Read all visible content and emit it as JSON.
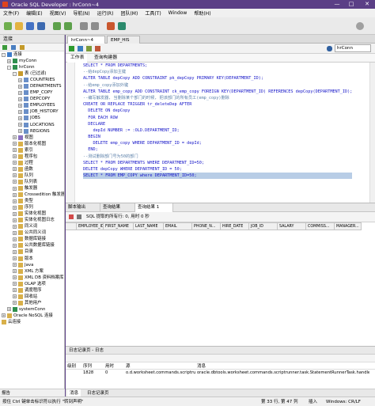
{
  "window": {
    "title": "Oracle SQL Developer : hrConn~4",
    "minimize": "—",
    "maximize": "□",
    "close": "✕"
  },
  "menu": [
    "文件(F)",
    "编辑(E)",
    "视图(V)",
    "导航(N)",
    "运行(R)",
    "团队(M)",
    "工具(T)",
    "Window",
    "帮助(H)"
  ],
  "sidebar": {
    "title": "连接",
    "items": [
      {
        "label": "连接",
        "depth": 0,
        "toggle": "-",
        "icon": "connections-icon"
      },
      {
        "label": "myConn",
        "depth": 1,
        "toggle": "+",
        "icon": "connection-icon"
      },
      {
        "label": "hrConn",
        "depth": 1,
        "toggle": "-",
        "icon": "connection-icon"
      },
      {
        "label": "表 (已过滤)",
        "depth": 2,
        "toggle": "-",
        "icon": "tables-icon"
      },
      {
        "label": "COUNTRIES",
        "depth": 3,
        "toggle": "+",
        "icon": "table-icon"
      },
      {
        "label": "DEPARTMENTS",
        "depth": 3,
        "toggle": "+",
        "icon": "table-icon"
      },
      {
        "label": "EMP_COPY",
        "depth": 3,
        "toggle": "+",
        "icon": "table-icon"
      },
      {
        "label": "DEPCOPY",
        "depth": 3,
        "toggle": "+",
        "icon": "table-icon"
      },
      {
        "label": "EMPLOYEES",
        "depth": 3,
        "toggle": "+",
        "icon": "table-icon"
      },
      {
        "label": "JOB_HISTORY",
        "depth": 3,
        "toggle": "+",
        "icon": "table-icon"
      },
      {
        "label": "JOBS",
        "depth": 3,
        "toggle": "+",
        "icon": "table-icon"
      },
      {
        "label": "LOCATIONS",
        "depth": 3,
        "toggle": "+",
        "icon": "table-icon"
      },
      {
        "label": "REGIONS",
        "depth": 3,
        "toggle": "+",
        "icon": "table-icon"
      },
      {
        "label": "视图",
        "depth": 2,
        "toggle": "+",
        "icon": "views-icon"
      },
      {
        "label": "版本化视图",
        "depth": 2,
        "toggle": "+",
        "icon": "folder-icon"
      },
      {
        "label": "索引",
        "depth": 2,
        "toggle": "+",
        "icon": "folder-icon"
      },
      {
        "label": "程序包",
        "depth": 2,
        "toggle": "+",
        "icon": "folder-icon"
      },
      {
        "label": "过程",
        "depth": 2,
        "toggle": "+",
        "icon": "folder-icon"
      },
      {
        "label": "函数",
        "depth": 2,
        "toggle": "+",
        "icon": "folder-icon"
      },
      {
        "label": "队列",
        "depth": 2,
        "toggle": "+",
        "icon": "folder-icon"
      },
      {
        "label": "队列表",
        "depth": 2,
        "toggle": "+",
        "icon": "folder-icon"
      },
      {
        "label": "触发器",
        "depth": 2,
        "toggle": "+",
        "icon": "folder-icon"
      },
      {
        "label": "Crossedition 触发器",
        "depth": 2,
        "toggle": "+",
        "icon": "folder-icon"
      },
      {
        "label": "类型",
        "depth": 2,
        "toggle": "+",
        "icon": "folder-icon"
      },
      {
        "label": "序列",
        "depth": 2,
        "toggle": "+",
        "icon": "folder-icon"
      },
      {
        "label": "实体化视图",
        "depth": 2,
        "toggle": "+",
        "icon": "folder-icon"
      },
      {
        "label": "实体化视图日志",
        "depth": 2,
        "toggle": "+",
        "icon": "folder-icon"
      },
      {
        "label": "同义词",
        "depth": 2,
        "toggle": "+",
        "icon": "folder-icon"
      },
      {
        "label": "公共同义词",
        "depth": 2,
        "toggle": "+",
        "icon": "folder-icon"
      },
      {
        "label": "数据库链接",
        "depth": 2,
        "toggle": "+",
        "icon": "folder-icon"
      },
      {
        "label": "公共数据库链接",
        "depth": 2,
        "toggle": "+",
        "icon": "folder-icon"
      },
      {
        "label": "目录",
        "depth": 2,
        "toggle": "+",
        "icon": "folder-icon"
      },
      {
        "label": "版本",
        "depth": 2,
        "toggle": "+",
        "icon": "folder-icon"
      },
      {
        "label": "Java",
        "depth": 2,
        "toggle": "+",
        "icon": "folder-icon"
      },
      {
        "label": "XML 方案",
        "depth": 2,
        "toggle": "+",
        "icon": "folder-icon"
      },
      {
        "label": "XML DB 资料档案库",
        "depth": 2,
        "toggle": "+",
        "icon": "folder-icon"
      },
      {
        "label": "OLAP 选项",
        "depth": 2,
        "toggle": "+",
        "icon": "folder-icon"
      },
      {
        "label": "调度程序",
        "depth": 2,
        "toggle": "+",
        "icon": "folder-icon"
      },
      {
        "label": "回收站",
        "depth": 2,
        "toggle": "+",
        "icon": "folder-icon"
      },
      {
        "label": "其他用户",
        "depth": 2,
        "toggle": "+",
        "icon": "folder-icon"
      },
      {
        "label": "systemConn",
        "depth": 1,
        "toggle": "+",
        "icon": "connection-icon"
      },
      {
        "label": "Oracle NoSQL 连接",
        "depth": 0,
        "toggle": "+",
        "icon": "folder-icon"
      },
      {
        "label": "云连接",
        "depth": 0,
        "toggle": "",
        "icon": "folder-icon"
      }
    ],
    "footer": "报告"
  },
  "doc_tabs": [
    "hrConn~4",
    "EMP_HIS"
  ],
  "connection_selector": "hrConn",
  "editor_subtabs": [
    "工作表",
    "查询构建器"
  ],
  "code_lines": [
    {
      "text": "SELECT * FROM DEPARTMENTS;",
      "kind": "code"
    },
    {
      "text": "--给depCopy添加主键",
      "kind": "comment"
    },
    {
      "text": "ALTER TABLE depCopy ADD CONSTRAINT pk_depCopy PRIMARY KEY(DEPARTMENT_ID);",
      "kind": "code"
    },
    {
      "text": "--给emp_copy添加外键",
      "kind": "comment"
    },
    {
      "text": "ALTER TABLE emp_copy ADD CONSTRAINT ck_emp_copy FOREIGN KEY(DEPARTMENT_ID) REFERENCES depCopy(DEPARTMENT_ID);",
      "kind": "code"
    },
    {
      "text": "--编写触发器, 当删除某个部门的时候, 把该部门的所有员工(emp_copy)删除",
      "kind": "comment"
    },
    {
      "text": "CREATE OR REPLACE TRIGGER tr_deleteDep AFTER",
      "kind": "code"
    },
    {
      "text": "  DELETE ON depCopy",
      "kind": "code"
    },
    {
      "text": "  FOR EACH ROW",
      "kind": "code"
    },
    {
      "text": "  DECLARE",
      "kind": "code"
    },
    {
      "text": "    depId NUMBER := :OLD.DEPARTMENT_ID;",
      "kind": "code"
    },
    {
      "text": "  BEGIN",
      "kind": "code"
    },
    {
      "text": "    DELETE emp_copy WHERE DEPARTMENT_ID = depId;",
      "kind": "code"
    },
    {
      "text": "  END;",
      "kind": "code"
    },
    {
      "text": "--测试删除部门号为50的部门",
      "kind": "comment"
    },
    {
      "text": "SELECT * FROM DEPARTMENTS WHERE DEPARTMENT_ID=50;",
      "kind": "code"
    },
    {
      "text": "DELETE depCopy WHERE DEPARTMENT_ID = 50;",
      "kind": "code"
    },
    {
      "text": "SELECT * FROM EMP_COPY where DEPARTMENT_ID=50;",
      "kind": "highlight"
    }
  ],
  "result_tabs": [
    "脚本输出",
    "查询结果",
    "查询结果 1"
  ],
  "result_status": "SQL  提取的所有行: 0, 用时 0 秒",
  "grid_columns": [
    "EMPLOYEE_ID",
    "FIRST_NAME",
    "LAST_NAME",
    "EMAIL",
    "PHONE_N...",
    "HIRE_DATE",
    "JOB_ID",
    "SALARY",
    "COMMISS...",
    "MANAGER..."
  ],
  "log": {
    "title": "日志记录页 - 日志",
    "columns": [
      "级别",
      "序列",
      "用时",
      "源",
      "消息"
    ],
    "row": {
      "level": "",
      "seq": "1828",
      "time": "0",
      "source": "o.d.worksheet.commands.scriptrunner.task.StatementRunnerTask",
      "message": "oracle.dbtools.worksheet.commands.scriptrunner.task.StatementRunnerTask.handleEx"
    },
    "tabs": [
      "消息",
      "日志记录页"
    ]
  },
  "status": {
    "hint": "按住 Ctrl 键单击标识符以执行 \"转到声明\"",
    "position": "第 33 行, 第 47 列",
    "mode": "插入",
    "os": "Windows: CR/LF"
  }
}
